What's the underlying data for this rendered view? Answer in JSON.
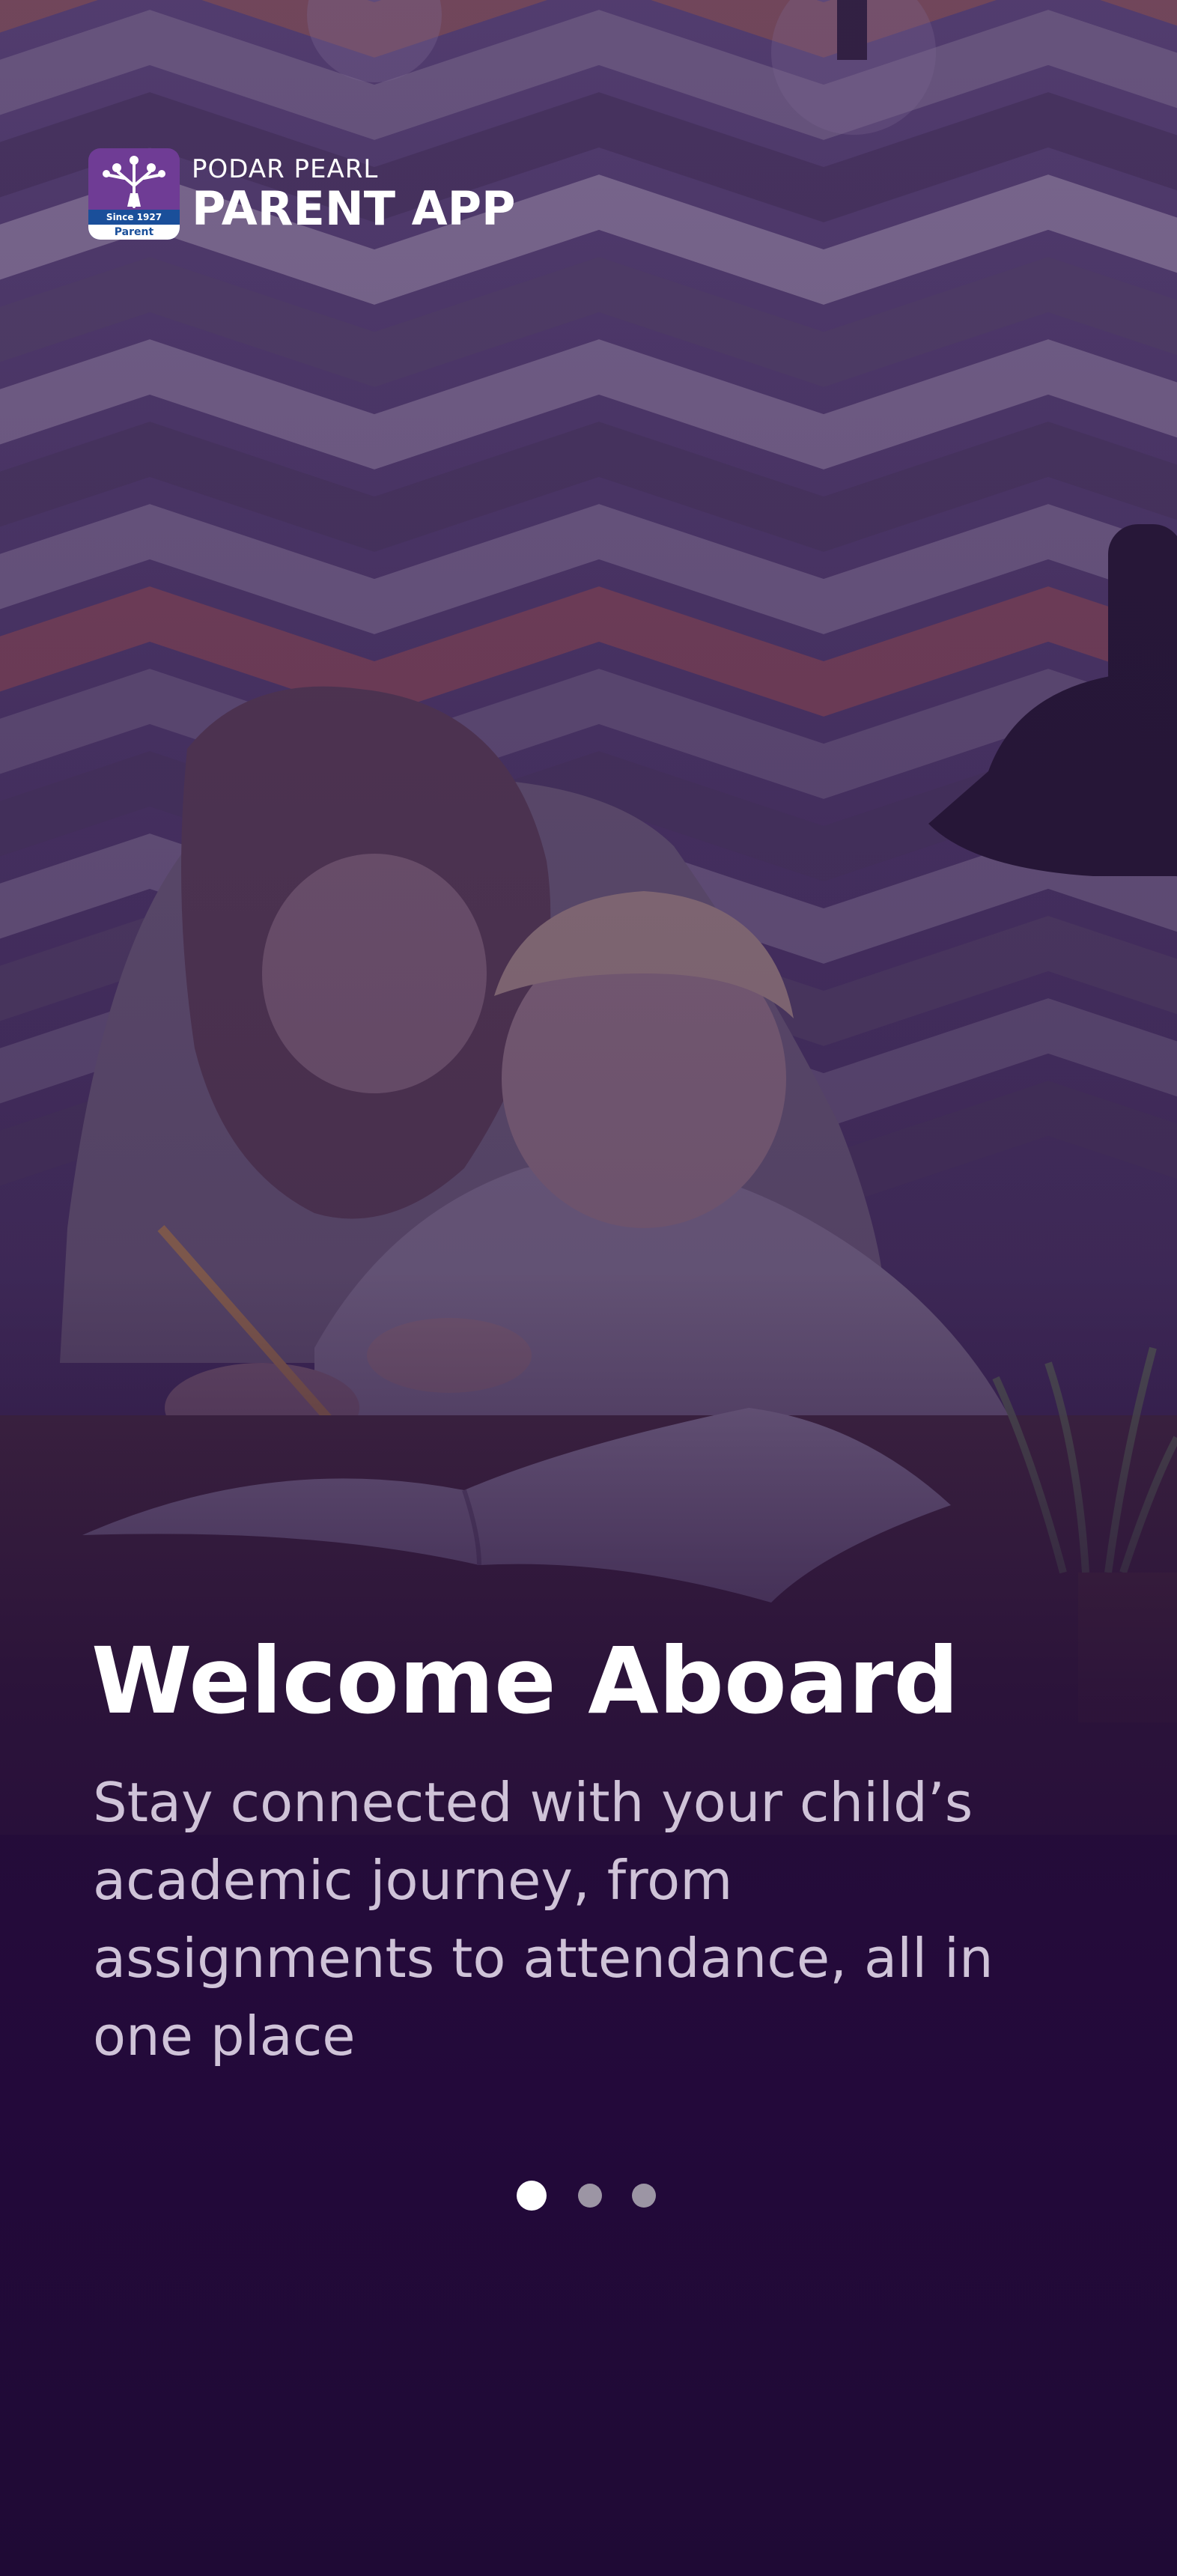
{
  "brand": {
    "line1": "PODAR PEARL",
    "line2": "PARENT APP",
    "badge_since": "Since 1927",
    "badge_label": "Parent"
  },
  "onboarding": {
    "title": "Welcome Aboard",
    "subtitle": "Stay connected with your child’s academic journey, from assignments to attendance, all in one place",
    "pages": 3,
    "active_page": 1
  },
  "colors": {
    "background": "#1f0a35",
    "accent_purple": "#6f3c95",
    "dot_active": "#ffffff",
    "dot_inactive": "#9c95a4"
  }
}
